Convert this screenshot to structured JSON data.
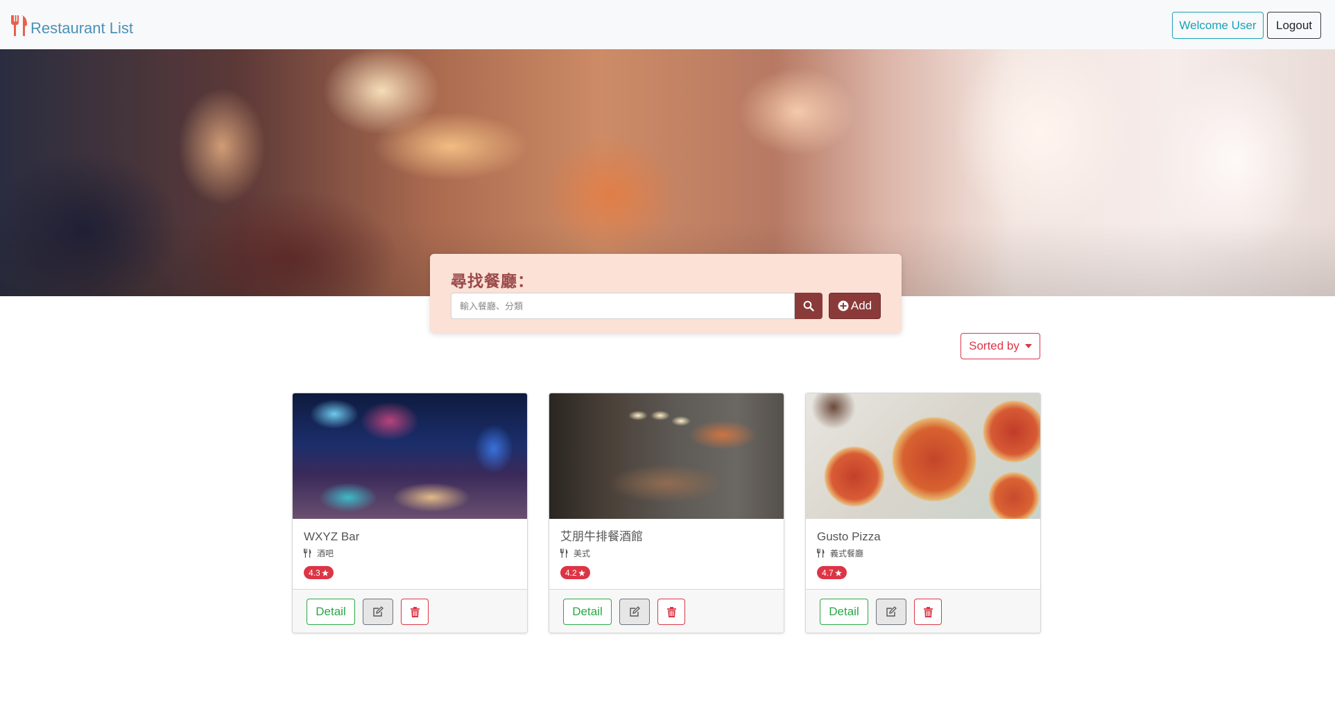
{
  "nav": {
    "brand": "Restaurant List",
    "welcome_label": "Welcome User",
    "logout_label": "Logout"
  },
  "search": {
    "title": "尋找餐廳：",
    "placeholder": "輸入餐廳、分類",
    "add_label": "Add"
  },
  "sort": {
    "label": "Sorted by"
  },
  "colors": {
    "brand_icon": "#e8614e",
    "brand_text": "#4a90b8",
    "accent": "#8b3a3a",
    "danger": "#dc3545",
    "success": "#28a745",
    "info": "#17a2b8"
  },
  "restaurants": [
    {
      "name": "WXYZ Bar",
      "category": "酒吧",
      "rating": "4.3",
      "detail_label": "Detail"
    },
    {
      "name": "艾朋牛排餐酒館",
      "category": "美式",
      "rating": "4.2",
      "detail_label": "Detail"
    },
    {
      "name": "Gusto Pizza",
      "category": "義式餐廳",
      "rating": "4.7",
      "detail_label": "Detail"
    }
  ]
}
